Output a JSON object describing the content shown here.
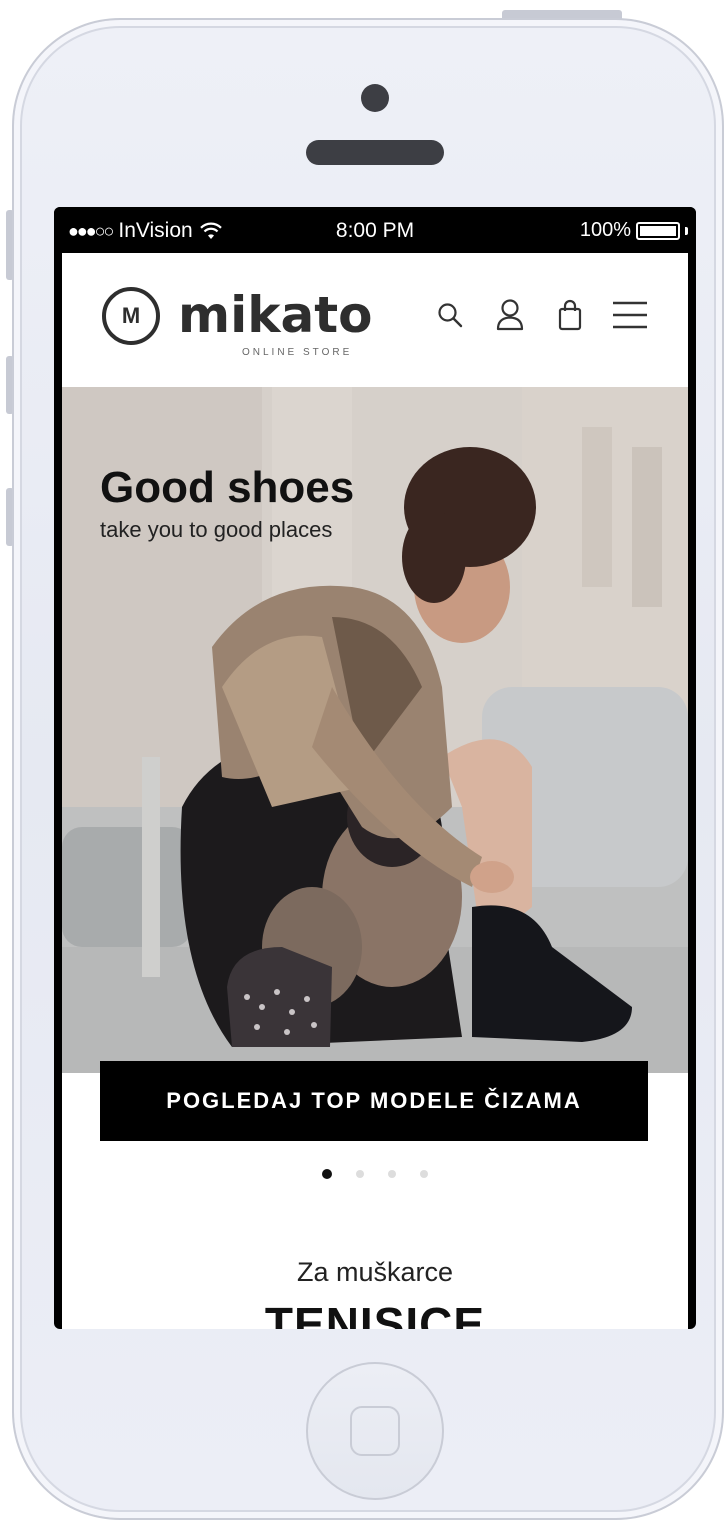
{
  "status_bar": {
    "signal_dots": "●●●○○",
    "carrier": "InVision",
    "time": "8:00 PM",
    "battery": "100%"
  },
  "header": {
    "logo_mark": "M",
    "logo_text": "mikato",
    "logo_tagline": "ONLINE STORE",
    "icons": [
      "search-icon",
      "user-icon",
      "bag-icon",
      "menu-icon"
    ]
  },
  "hero": {
    "title": "Good shoes",
    "subtitle": "take you to good places",
    "cta_label": "POGLEDAJ TOP MODELE ČIZAMA",
    "slides_count": 4,
    "active_slide": 1
  },
  "section": {
    "subtitle": "Za muškarce",
    "title": "TENISICE"
  },
  "colors": {
    "primary": "#000000",
    "text": "#111111",
    "phone_body": "#e9ebf3"
  }
}
